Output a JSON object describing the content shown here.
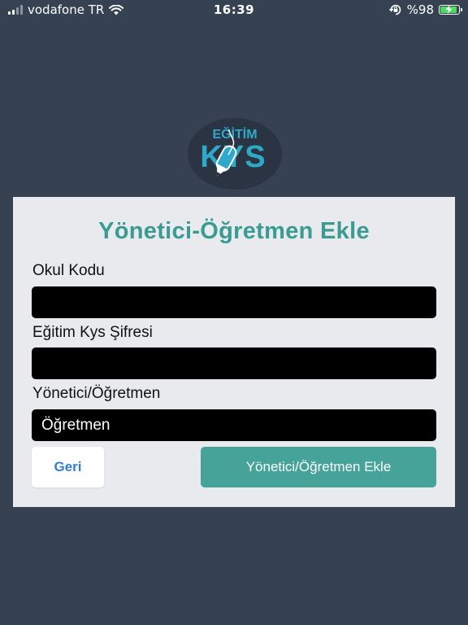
{
  "status_bar": {
    "carrier": "vodafone TR",
    "time": "16:39",
    "battery_percent": "%98",
    "battery_level": 0.98
  },
  "logo": {
    "top_text": "EĞİTİM",
    "main_text": "KYS"
  },
  "form": {
    "title": "Yönetici-Öğretmen Ekle",
    "fields": [
      {
        "label": "Okul Kodu",
        "value": ""
      },
      {
        "label": "Eğitim Kys Şifresi",
        "value": ""
      },
      {
        "label": "Yönetici/Öğretmen",
        "value": "Öğretmen"
      }
    ],
    "back_label": "Geri",
    "submit_label": "Yönetici/Öğretmen Ekle"
  },
  "colors": {
    "background": "#364152",
    "card": "#e8eaee",
    "accent": "#3a9b93",
    "button": "#45a39a",
    "link": "#2f7fd6"
  },
  "icons": [
    "signal-icon",
    "wifi-icon",
    "screen-rotation-lock-icon",
    "battery-icon",
    "pencil-mouse-icon"
  ]
}
